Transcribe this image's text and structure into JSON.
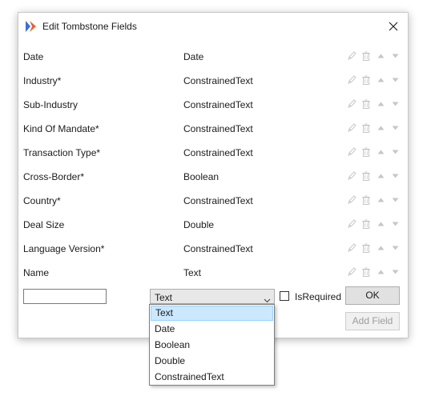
{
  "dialog": {
    "title": "Edit Tombstone Fields",
    "close_glyph": "✕"
  },
  "fields": [
    {
      "name": "Date",
      "type": "Date"
    },
    {
      "name": "Industry*",
      "type": "ConstrainedText"
    },
    {
      "name": "Sub-Industry",
      "type": "ConstrainedText"
    },
    {
      "name": "Kind Of Mandate*",
      "type": "ConstrainedText"
    },
    {
      "name": "Transaction Type*",
      "type": "ConstrainedText"
    },
    {
      "name": "Cross-Border*",
      "type": "Boolean"
    },
    {
      "name": "Country*",
      "type": "ConstrainedText"
    },
    {
      "name": "Deal Size",
      "type": "Double"
    },
    {
      "name": "Language Version*",
      "type": "ConstrainedText"
    },
    {
      "name": "Name",
      "type": "Text"
    }
  ],
  "row_action_icons": [
    "edit-pencil-icon",
    "delete-trash-icon",
    "move-up-icon",
    "move-down-icon"
  ],
  "new_field": {
    "name_value": "",
    "type_selected": "Text",
    "type_options": [
      "Text",
      "Date",
      "Boolean",
      "Double",
      "ConstrainedText"
    ],
    "is_required_label": "IsRequired",
    "is_required_checked": false
  },
  "buttons": {
    "ok_label": "OK",
    "add_field_label": "Add Field"
  },
  "colors": {
    "logo_blue": "#3b6fd6",
    "logo_orange": "#f0612b",
    "dropdown_highlight": "#cce8ff",
    "icon_disabled": "#c6c6c6"
  }
}
